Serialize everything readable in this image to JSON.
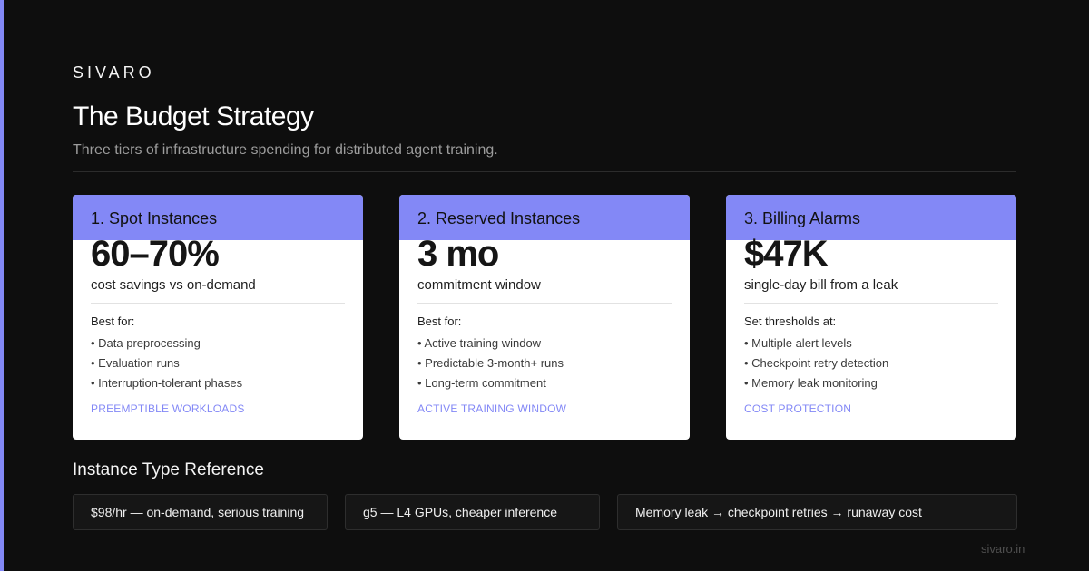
{
  "brand": "SIVARO",
  "title": "The Budget Strategy",
  "subtitle": "Three tiers of infrastructure spending for distributed agent training.",
  "colors": {
    "accent": "#8388f6",
    "background": "#0e0e0e",
    "card": "#ffffff"
  },
  "cards": [
    {
      "heading": "1. Spot Instances",
      "metric": "60–70%",
      "metric_label": "cost savings vs on-demand",
      "list_title": "Best for:",
      "items": [
        "• Data preprocessing",
        "• Evaluation runs",
        "• Interruption-tolerant phases"
      ],
      "tag": "PREEMPTIBLE WORKLOADS"
    },
    {
      "heading": "2. Reserved Instances",
      "metric": "3 mo",
      "metric_label": "commitment window",
      "list_title": "Best for:",
      "items": [
        "• Active training window",
        "• Predictable 3-month+ runs",
        "• Long-term commitment"
      ],
      "tag": "ACTIVE TRAINING WINDOW"
    },
    {
      "heading": "3. Billing Alarms",
      "metric": "$47K",
      "metric_label": "single-day bill from a leak",
      "list_title": "Set thresholds at:",
      "items": [
        "• Multiple alert levels",
        "• Checkpoint retry detection",
        "• Memory leak monitoring"
      ],
      "tag": "COST PROTECTION"
    }
  ],
  "reference": {
    "title": "Instance Type Reference",
    "chips": [
      "$98/hr — on-demand, serious training",
      "g5 — L4 GPUs, cheaper inference",
      "Memory leak → checkpoint retries → runaway cost"
    ]
  },
  "footer": "sivaro.in"
}
